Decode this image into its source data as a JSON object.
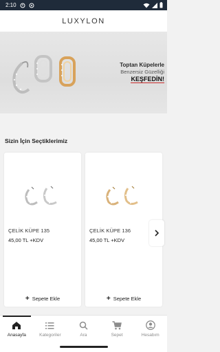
{
  "status_bar": {
    "time": "2:10"
  },
  "header": {
    "logo_text": "LUXYLON"
  },
  "banner": {
    "line1": "Toptan Küpelerle",
    "line2": "Benzersiz Güzelliği",
    "cta": "KEŞFEDİN!"
  },
  "section": {
    "title": "Sizin İçin Seçtiklerimiz"
  },
  "products": [
    {
      "name": "ÇELİK KÜPE 135",
      "price": "45,00 TL +KDV",
      "add_label": "Sepete Ekle",
      "color": "#c9c9c9"
    },
    {
      "name": "ÇELİK KÜPE 136",
      "price": "45,00 TL +KDV",
      "add_label": "Sepete Ekle",
      "color": "#d9b27a"
    }
  ],
  "nav": {
    "items": [
      {
        "label": "Anasayfa",
        "icon": "home-icon"
      },
      {
        "label": "Kategoriler",
        "icon": "list-icon"
      },
      {
        "label": "Ara",
        "icon": "search-icon"
      },
      {
        "label": "Sepet",
        "icon": "cart-icon"
      },
      {
        "label": "Hesabım",
        "icon": "account-icon"
      }
    ],
    "active": "Anasayfa"
  },
  "colors": {
    "status_bar": "#1f2b3a",
    "accent_underline": "#c62828",
    "background": "#f2f2f2"
  }
}
